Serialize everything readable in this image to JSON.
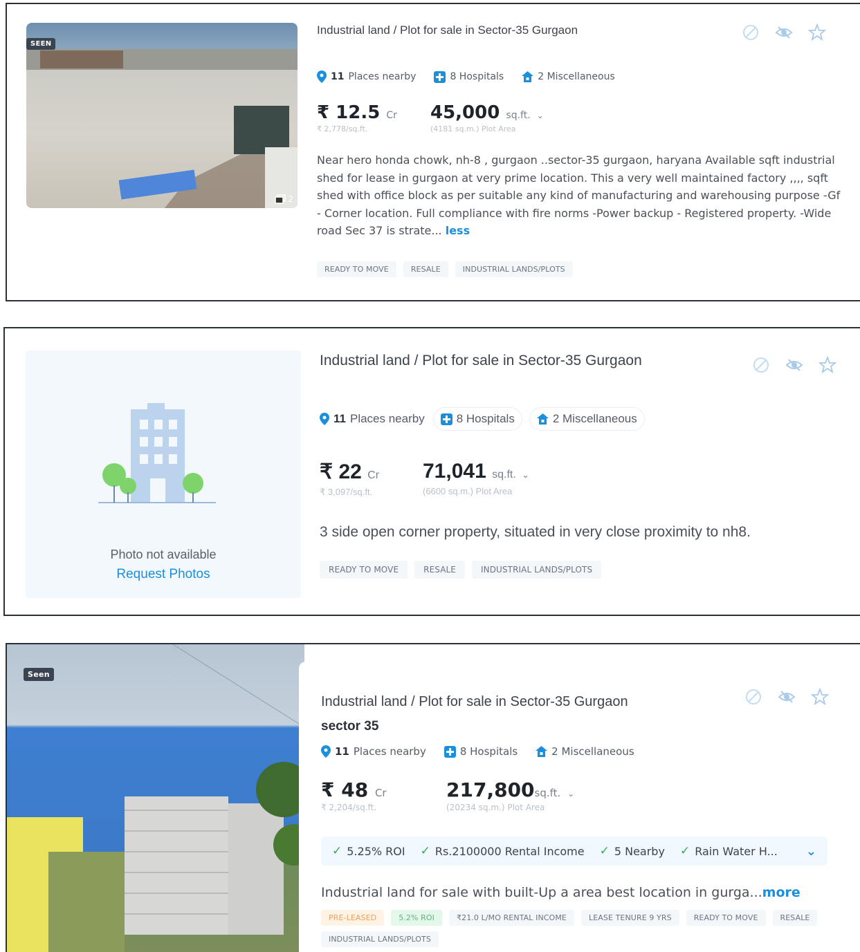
{
  "listings": [
    {
      "seen_label": "SEEN",
      "photo_count": "2",
      "title": "Industrial land / Plot for sale in Sector-35 Gurgaon",
      "places": {
        "count": "11",
        "label": "Places nearby"
      },
      "hospitals": "8 Hospitals",
      "misc": "2 Miscellaneous",
      "price": {
        "symbol": "₹",
        "value": "12.5",
        "unit": "Cr",
        "per_sqft": "₹ 2,778/sq.ft."
      },
      "area": {
        "value": "45,000",
        "unit": "sq.ft.",
        "sub": "(4181 sq.m.) Plot Area"
      },
      "description": "Near hero honda chowk, nh-8 , gurgaon ..sector-35 gurgaon, haryana Available sqft industrial shed for lease in gurgaon at very prime location. This a very well maintained factory ,,,, sqft shed with office block as per suitable any kind of manufacturing and warehousing purpose -Gf - Corner location. Full compliance with fire norms -Power backup - Registered property. -Wide road Sec 37 is strate...",
      "toggle_link": "less",
      "tags": [
        "READY TO MOVE",
        "RESALE",
        "INDUSTRIAL LANDS/PLOTS"
      ]
    },
    {
      "photo_unavailable": "Photo not available",
      "request_photos": "Request Photos",
      "title": "Industrial land / Plot for sale in Sector-35 Gurgaon",
      "places": {
        "count": "11",
        "label": "Places nearby"
      },
      "hospitals": "8 Hospitals",
      "misc": "2 Miscellaneous",
      "price": {
        "symbol": "₹",
        "value": "22",
        "unit": "Cr",
        "per_sqft": "₹ 3,097/sq.ft."
      },
      "area": {
        "value": "71,041",
        "unit": "sq.ft.",
        "sub": "(6600 sq.m.) Plot Area"
      },
      "description": "3 side open corner property, situated in very close proximity to nh8.",
      "tags": [
        "READY TO MOVE",
        "RESALE",
        "INDUSTRIAL LANDS/PLOTS"
      ]
    },
    {
      "seen_label": "Seen",
      "title": "Industrial land / Plot for sale in Sector-35 Gurgaon",
      "subtitle": "sector 35",
      "places": {
        "count": "11",
        "label": "Places nearby"
      },
      "hospitals": "8 Hospitals",
      "misc": "2 Miscellaneous",
      "price": {
        "symbol": "₹",
        "value": "48",
        "unit": "Cr",
        "per_sqft": "₹ 2,204/sq.ft."
      },
      "area": {
        "value": "217,800",
        "unit": "sq.ft.",
        "sub": "(20234 sq.m.) Plot Area"
      },
      "features": [
        "5.25% ROI",
        "Rs.2100000 Rental Income",
        "5 Nearby",
        "Rain Water H..."
      ],
      "description": "Industrial land for sale with built-Up a area best location in gurga...",
      "toggle_link": "more",
      "tags_colored": [
        "PRE-LEASED",
        "5.2% ROI"
      ],
      "tags": [
        "₹21.0 L/MO RENTAL INCOME",
        "LEASE TENURE 9 YRS",
        "READY TO MOVE",
        "RESALE",
        "INDUSTRIAL LANDS/PLOTS"
      ]
    }
  ],
  "colors": {
    "accent": "#1a8fdc",
    "check": "#2fae4f",
    "border": "#2b2f36"
  },
  "icons": [
    "location-pin-icon",
    "hospital-icon",
    "miscellaneous-icon",
    "block-icon",
    "hide-icon",
    "star-icon",
    "gallery-icon",
    "building-icon",
    "check-icon",
    "chevron-down-icon"
  ]
}
